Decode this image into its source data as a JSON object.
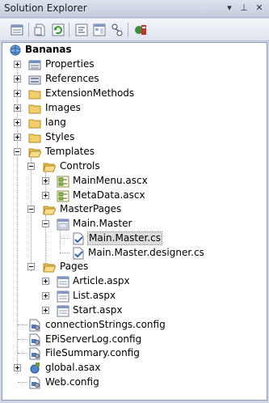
{
  "window": {
    "title": "Solution Explorer",
    "controls": {
      "dropdown": "▾",
      "pin": "⊥",
      "close": "✕"
    }
  },
  "toolbar": {
    "buttons": [
      "properties-icon",
      "show-all-files-icon",
      "refresh-icon",
      "view-code-icon",
      "view-designer-icon",
      "class-diagram-icon",
      "copy-website-icon"
    ]
  },
  "tree": {
    "root": "Bananas",
    "items": [
      {
        "label": "Properties"
      },
      {
        "label": "References"
      },
      {
        "label": "ExtensionMethods"
      },
      {
        "label": "Images"
      },
      {
        "label": "lang"
      },
      {
        "label": "Styles"
      },
      {
        "label": "Templates"
      },
      {
        "label": "Controls"
      },
      {
        "label": "MainMenu.ascx"
      },
      {
        "label": "MetaData.ascx"
      },
      {
        "label": "MasterPages"
      },
      {
        "label": "Main.Master"
      },
      {
        "label": "Main.Master.cs"
      },
      {
        "label": "Main.Master.designer.cs"
      },
      {
        "label": "Pages"
      },
      {
        "label": "Article.aspx"
      },
      {
        "label": "List.aspx"
      },
      {
        "label": "Start.aspx"
      },
      {
        "label": "connectionStrings.config"
      },
      {
        "label": "EPiServerLog.config"
      },
      {
        "label": "FileSummary.config"
      },
      {
        "label": "global.asax"
      },
      {
        "label": "Web.config"
      }
    ]
  }
}
